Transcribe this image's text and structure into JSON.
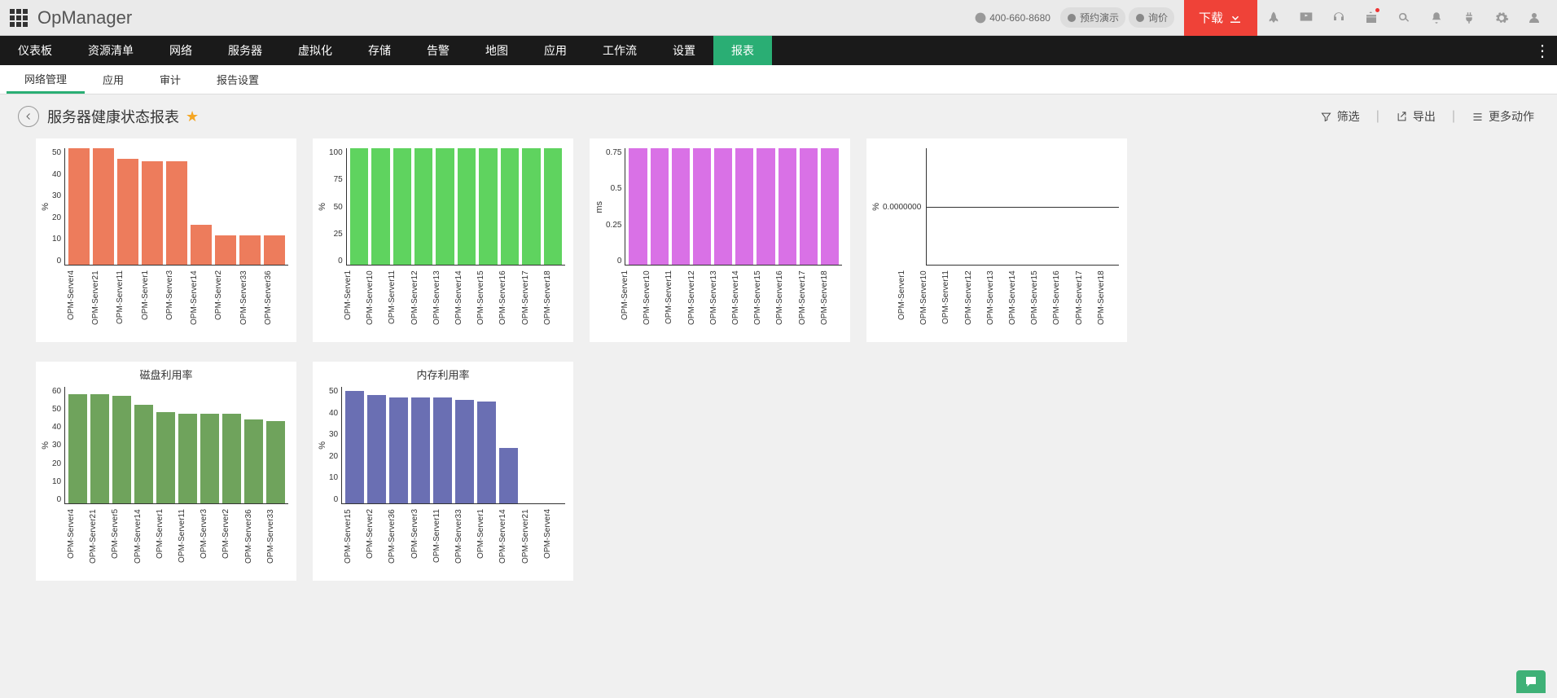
{
  "brand": "OpManager",
  "topbar": {
    "phone": "400-660-8680",
    "demo_label": "预约演示",
    "quote_label": "询价",
    "download_label": "下载"
  },
  "main_nav": {
    "items": [
      "仪表板",
      "资源清单",
      "网络",
      "服务器",
      "虚拟化",
      "存储",
      "告警",
      "地图",
      "应用",
      "工作流",
      "设置",
      "报表"
    ],
    "active_index": 11
  },
  "sub_nav": {
    "items": [
      "网络管理",
      "应用",
      "审计",
      "报告设置"
    ],
    "active_index": 0
  },
  "page": {
    "title": "服务器健康状态报表",
    "filter_label": "筛选",
    "export_label": "导出",
    "more_label": "更多动作"
  },
  "chart_data": [
    {
      "type": "bar",
      "title": "",
      "ylabel": "%",
      "color": "#ed7c5c",
      "ylim": [
        0,
        55
      ],
      "yticks": [
        0,
        10,
        20,
        30,
        40,
        50
      ],
      "categories": [
        "OPM-Server4",
        "OPM-Server21",
        "OPM-Server11",
        "OPM-Server1",
        "OPM-Server3",
        "OPM-Server14",
        "OPM-Server2",
        "OPM-Server33",
        "OPM-Server36"
      ],
      "values": [
        55,
        55,
        50,
        49,
        49,
        19,
        14,
        14,
        14
      ]
    },
    {
      "type": "bar",
      "title": "",
      "ylabel": "%",
      "color": "#5fd35f",
      "ylim": [
        0,
        100
      ],
      "yticks": [
        0,
        25,
        50,
        75,
        100
      ],
      "categories": [
        "OPM-Server1",
        "OPM-Server10",
        "OPM-Server11",
        "OPM-Server12",
        "OPM-Server13",
        "OPM-Server14",
        "OPM-Server15",
        "OPM-Server16",
        "OPM-Server17",
        "OPM-Server18"
      ],
      "values": [
        100,
        100,
        100,
        100,
        100,
        100,
        100,
        100,
        100,
        100
      ]
    },
    {
      "type": "bar",
      "title": "",
      "ylabel": "ms",
      "color": "#d971e6",
      "ylim": [
        0,
        1.0
      ],
      "yticks": [
        0.0,
        0.25,
        0.5,
        0.75
      ],
      "categories": [
        "OPM-Server1",
        "OPM-Server10",
        "OPM-Server11",
        "OPM-Server12",
        "OPM-Server13",
        "OPM-Server14",
        "OPM-Server15",
        "OPM-Server16",
        "OPM-Server17",
        "OPM-Server18"
      ],
      "values": [
        1.0,
        1.0,
        1.0,
        1.0,
        1.0,
        1.0,
        1.0,
        1.0,
        1.0,
        1.0
      ]
    },
    {
      "type": "bar",
      "title": "",
      "ylabel": "%",
      "color": "#888",
      "ylim": [
        -1,
        1
      ],
      "yticks_single": "0.0000000",
      "categories": [
        "OPM-Server1",
        "OPM-Server10",
        "OPM-Server11",
        "OPM-Server12",
        "OPM-Server13",
        "OPM-Server14",
        "OPM-Server15",
        "OPM-Server16",
        "OPM-Server17",
        "OPM-Server18"
      ],
      "values": [
        0,
        0,
        0,
        0,
        0,
        0,
        0,
        0,
        0,
        0
      ]
    },
    {
      "type": "bar",
      "title": "磁盘利用率",
      "ylabel": "%",
      "color": "#6fa35c",
      "ylim": [
        0,
        65
      ],
      "yticks": [
        0,
        10,
        20,
        30,
        40,
        50,
        60
      ],
      "categories": [
        "OPM-Server4",
        "OPM-Server21",
        "OPM-Server5",
        "OPM-Server14",
        "OPM-Server1",
        "OPM-Server11",
        "OPM-Server3",
        "OPM-Server2",
        "OPM-Server36",
        "OPM-Server33"
      ],
      "values": [
        61,
        61,
        60,
        55,
        51,
        50,
        50,
        50,
        47,
        46
      ]
    },
    {
      "type": "bar",
      "title": "内存利用率",
      "ylabel": "%",
      "color": "#6a6fb3",
      "ylim": [
        0,
        55
      ],
      "yticks": [
        0,
        10,
        20,
        30,
        40,
        50
      ],
      "categories": [
        "OPM-Server15",
        "OPM-Server2",
        "OPM-Server36",
        "OPM-Server3",
        "OPM-Server11",
        "OPM-Server33",
        "OPM-Server1",
        "OPM-Server14",
        "OPM-Server21",
        "OPM-Server4"
      ],
      "values": [
        53,
        51,
        50,
        50,
        50,
        49,
        48,
        26,
        0,
        0
      ]
    }
  ]
}
